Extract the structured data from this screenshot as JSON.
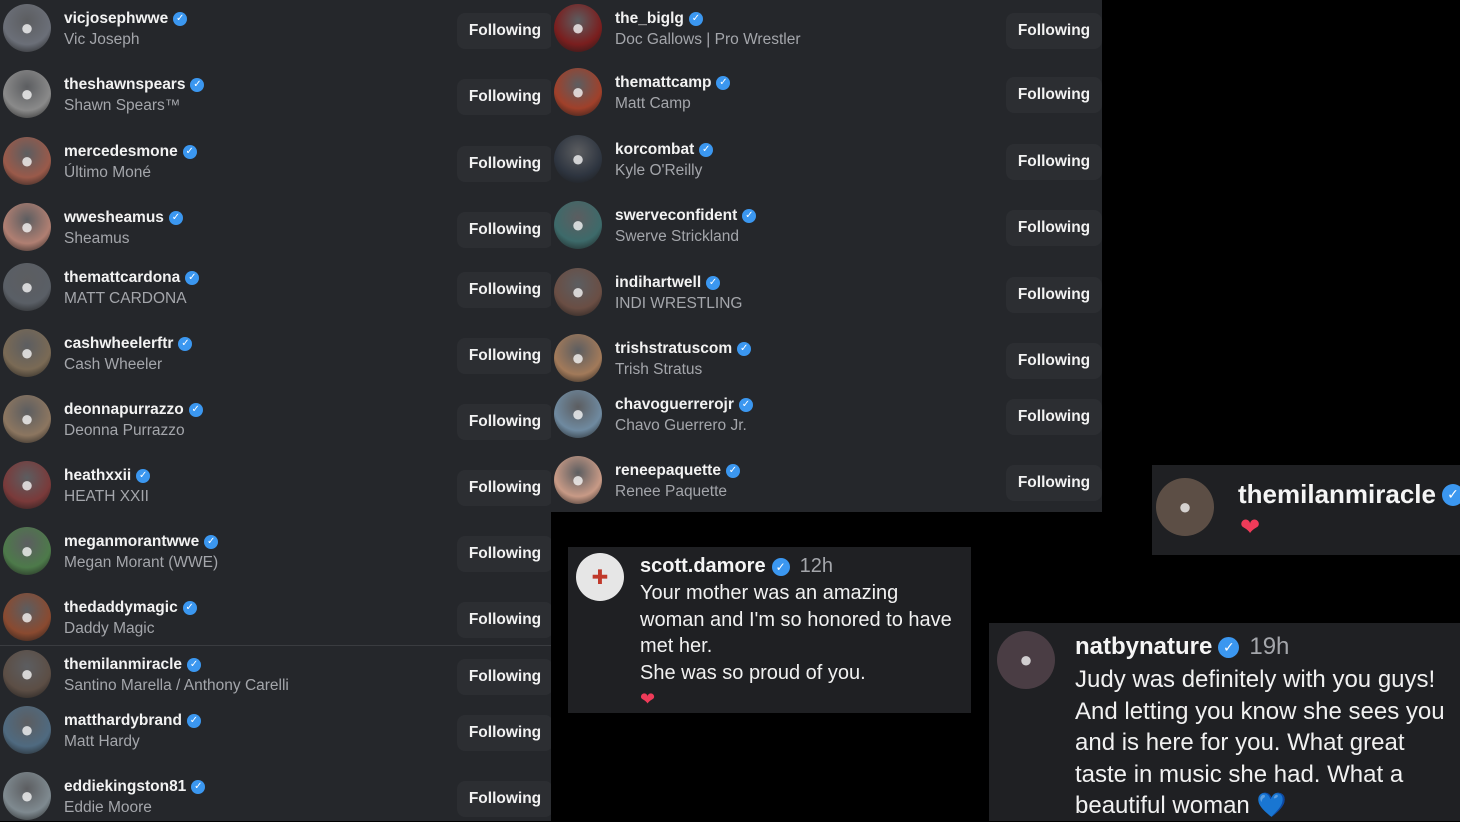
{
  "following_label": "Following",
  "left_list": [
    {
      "username": "vicjosephwwe",
      "fullname": "Vic Joseph",
      "avatar_color": "#6b6f78"
    },
    {
      "username": "theshawnspears",
      "fullname": "Shawn Spears™",
      "avatar_color": "#8a8a8a"
    },
    {
      "username": "mercedesmone",
      "fullname": "Último Moné",
      "avatar_color": "#9a5a4a"
    },
    {
      "username": "wwesheamus",
      "fullname": "Sheamus",
      "avatar_color": "#b07f72"
    },
    {
      "username": "themattcardona",
      "fullname": "MATT CARDONA",
      "avatar_color": "#5a5f66"
    },
    {
      "username": "cashwheelerftr",
      "fullname": "Cash Wheeler",
      "avatar_color": "#7a6a55"
    },
    {
      "username": "deonnapurrazzo",
      "fullname": "Deonna Purrazzo",
      "avatar_color": "#8c7660"
    },
    {
      "username": "heathxxii",
      "fullname": "HEATH XXII",
      "avatar_color": "#7a3a3a"
    },
    {
      "username": "meganmorantwwe",
      "fullname": "Megan Morant (WWE)",
      "avatar_color": "#4d7a4a"
    },
    {
      "username": "thedaddymagic",
      "fullname": "Daddy Magic",
      "avatar_color": "#8a4a30"
    },
    {
      "username": "themilanmiracle",
      "fullname": "Santino Marella / Anthony Carelli",
      "avatar_color": "#5c4e45"
    },
    {
      "username": "matthardybrand",
      "fullname": "Matt Hardy",
      "avatar_color": "#4f6a80"
    },
    {
      "username": "eddiekingston81",
      "fullname": "Eddie Moore",
      "avatar_color": "#7f8a90"
    }
  ],
  "right_list": [
    {
      "username": "the_biglg",
      "fullname": "Doc Gallows | Pro Wrestler",
      "avatar_color": "#7a1e1e"
    },
    {
      "username": "themattcamp",
      "fullname": "Matt Camp",
      "avatar_color": "#a0402a"
    },
    {
      "username": "korcombat",
      "fullname": "Kyle O'Reilly",
      "avatar_color": "#2e3540"
    },
    {
      "username": "swerveconfident",
      "fullname": "Swerve Strickland",
      "avatar_color": "#3d6a6a"
    },
    {
      "username": "indihartwell",
      "fullname": "INDI WRESTLING",
      "avatar_color": "#6a4e44"
    },
    {
      "username": "trishstratuscom",
      "fullname": "Trish Stratus",
      "avatar_color": "#a27a5a"
    },
    {
      "username": "chavoguerrerojr",
      "fullname": "Chavo Guerrero Jr.",
      "avatar_color": "#6f8aa0"
    },
    {
      "username": "reneepaquette",
      "fullname": "Renee Paquette",
      "avatar_color": "#c89a86"
    }
  ],
  "comments": {
    "scott": {
      "username": "scott.damore",
      "time": "12h",
      "lines": [
        "Your mother was an amazing",
        "woman and I'm so honored to have",
        "met her.",
        "She was so proud of you."
      ],
      "emoji": "❤",
      "avatar_color": "#e6e6e6"
    },
    "nat": {
      "username": "natbynature",
      "time": "19h",
      "lines": [
        "Judy was definitely with you guys!",
        "And letting you know she sees you",
        "and is here for you. What great",
        "taste in music she had. What a",
        "beautiful woman"
      ],
      "emoji": "💙",
      "avatar_color": "#4a3d44"
    },
    "milan": {
      "username": "themilanmiracle",
      "emoji": "❤",
      "avatar_color": "#5c4e45"
    }
  },
  "colors": {
    "panel": "#25272b",
    "badge": "#3b97f0",
    "heart": "#ef3b59"
  }
}
